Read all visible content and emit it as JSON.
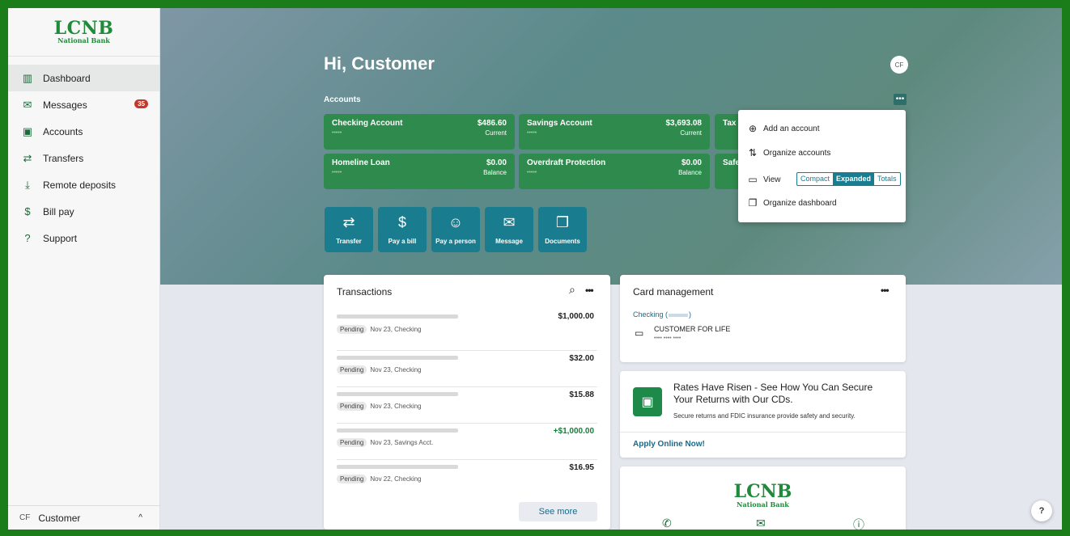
{
  "brand": {
    "logo_big": "LCNB",
    "logo_small": "National Bank"
  },
  "sidebar": {
    "items": [
      {
        "label": "Dashboard",
        "icon": "dashboard-icon",
        "glyph": "▥"
      },
      {
        "label": "Messages",
        "icon": "envelope-icon",
        "glyph": "✉",
        "badge": "35"
      },
      {
        "label": "Accounts",
        "icon": "accounts-icon",
        "glyph": "▣"
      },
      {
        "label": "Transfers",
        "icon": "transfer-icon",
        "glyph": "⇄"
      },
      {
        "label": "Remote deposits",
        "icon": "deposit-icon",
        "glyph": "⤓"
      },
      {
        "label": "Bill pay",
        "icon": "bill-icon",
        "glyph": "$"
      },
      {
        "label": "Support",
        "icon": "help-circle-icon",
        "glyph": "?"
      }
    ],
    "user": {
      "initials": "CF",
      "name": "Customer",
      "caret": "^"
    }
  },
  "header": {
    "greeting": "Hi, Customer",
    "avatar": "CF"
  },
  "accounts": {
    "title": "Accounts",
    "more": "•••",
    "cards": [
      {
        "name": "Checking Account",
        "amount": "$486.60",
        "label": "Current"
      },
      {
        "name": "Savings Account",
        "amount": "$3,693.08",
        "label": "Current"
      },
      {
        "name": "Tax"
      },
      {
        "name": "Homeline Loan",
        "amount": "$0.00",
        "label": "Balance"
      },
      {
        "name": "Overdraft Protection",
        "amount": "$0.00",
        "label": "Balance"
      },
      {
        "name": "Safe"
      }
    ]
  },
  "quick_actions": [
    {
      "label": "Transfer",
      "glyph": "⇄"
    },
    {
      "label": "Pay a bill",
      "glyph": "$"
    },
    {
      "label": "Pay a person",
      "glyph": "☺"
    },
    {
      "label": "Message",
      "glyph": "✉"
    },
    {
      "label": "Documents",
      "glyph": "❐"
    }
  ],
  "dropdown": {
    "add": "Add an account",
    "organize": "Organize accounts",
    "view": "View",
    "view_options": [
      "Compact",
      "Expanded",
      "Totals"
    ],
    "view_selected": "Expanded",
    "dashboard": "Organize dashboard"
  },
  "transactions": {
    "title": "Transactions",
    "more": "•••",
    "rows": [
      {
        "status": "Pending",
        "meta": "Nov 23, Checking",
        "amount": "$1,000.00"
      },
      {
        "status": "Pending",
        "meta": "Nov 23, Checking",
        "amount": "$32.00"
      },
      {
        "status": "Pending",
        "meta": "Nov 23, Checking",
        "amount": "$15.88"
      },
      {
        "status": "Pending",
        "meta": "Nov 23, Savings Acct.",
        "amount": "+$1,000.00"
      },
      {
        "status": "Pending",
        "meta": "Nov 22, Checking",
        "amount": "$16.95"
      }
    ],
    "see_more": "See more"
  },
  "card_mgmt": {
    "title": "Card management",
    "more": "•••",
    "account": "Checking (",
    "account_end": ")",
    "card_name": "CUSTOMER FOR LIFE",
    "card_mask": "•••• •••• ••••"
  },
  "promo": {
    "headline": "Rates Have Risen - See How You Can Secure Your Returns with Our CDs.",
    "body": "Secure returns and FDIC insurance provide safety and security.",
    "link": "Apply Online Now!"
  },
  "help": "?"
}
